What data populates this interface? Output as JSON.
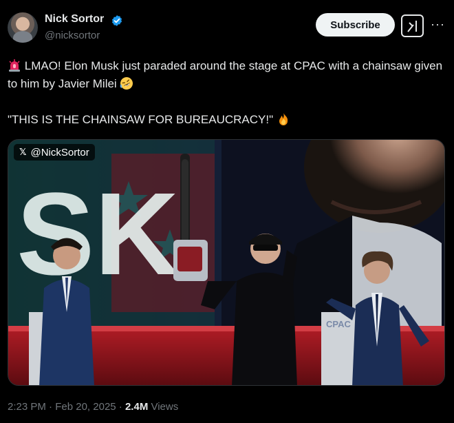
{
  "author": {
    "name": "Nick Sortor",
    "handle": "@nicksortor"
  },
  "actions": {
    "subscribe_label": "Subscribe",
    "more_label": "···"
  },
  "post": {
    "line1": "LMAO! Elon Musk just paraded around the stage at CPAC with a chainsaw given to him by Javier Milei",
    "line2": "\"THIS IS THE CHAINSAW FOR BUREAUCRACY!\""
  },
  "media": {
    "watermark_text": "@NickSortor",
    "stage_sign": "CPAC"
  },
  "meta": {
    "time": "2:23 PM",
    "separator1": " · ",
    "date": "Feb 20, 2025",
    "separator2": " · ",
    "views_count": "2.4M",
    "views_label": " Views"
  }
}
